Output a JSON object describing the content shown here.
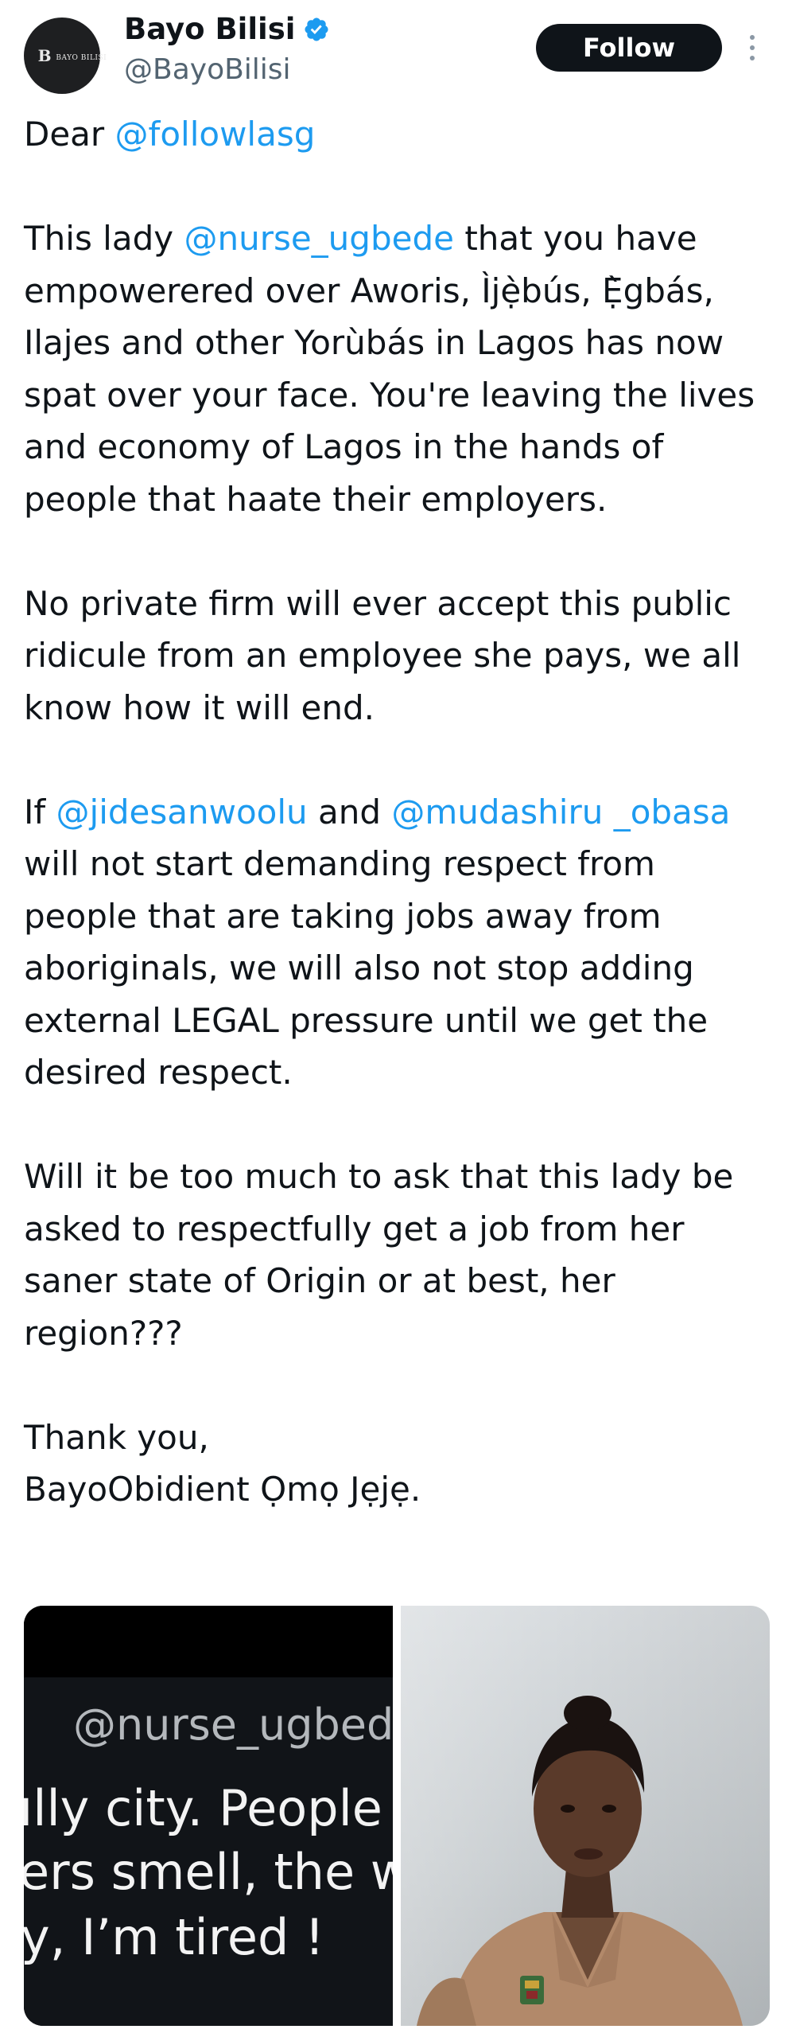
{
  "author": {
    "display_name": "Bayo Bilisi",
    "handle": "@BayoBilisi",
    "avatar_text_big": "B",
    "avatar_text_small": "BAYO BILISI",
    "verified": true,
    "verified_color": "#1d9bf0"
  },
  "actions": {
    "follow_label": "Follow",
    "more_icon": "more-vertical-icon"
  },
  "tweet": {
    "p1": {
      "t0": "Dear ",
      "m0": "@followlasg"
    },
    "p2": {
      "t0": "This lady ",
      "m0": "@nurse_ugbede",
      "t1": " that you have empowerered over Aworis, Ìjẹ̀bús, Ẹ̀gbás, Ilajes and other Yorùbás in Lagos has now spat over your face. You're leaving the lives and economy of Lagos in the hands of people that haate their employers."
    },
    "p3": "No private firm will ever accept this public ridicule from an employee she pays, we all know how it will end.",
    "p4": {
      "t0": "If ",
      "m0": "@jidesanwoolu",
      "t1": " and ",
      "m1": "@mudashiru _obasa",
      "t2": " will not start demanding respect from people that are taking jobs away from aboriginals, we will also not stop adding external LEGAL pressure until we get the desired respect."
    },
    "p5": "Will it be too much to ask that this lady be asked to respectfully get a job from her saner state of Origin or at best, her region???",
    "p6a": "Thank you,",
    "p6b": "BayoObidient Ọmọ Jẹjẹ."
  },
  "media": {
    "left_overlay": {
      "handle": "@nurse_ugbede",
      "line1": "ılly city. People sı",
      "line2": "ers smell, the wa",
      "line3": "y, I’m tired !"
    },
    "right_photo": "photo-of-woman-in-nurse-uniform"
  },
  "colors": {
    "link": "#1d9bf0",
    "text": "#0f1419",
    "secondary": "#536471",
    "follow_bg": "#0f1419"
  }
}
